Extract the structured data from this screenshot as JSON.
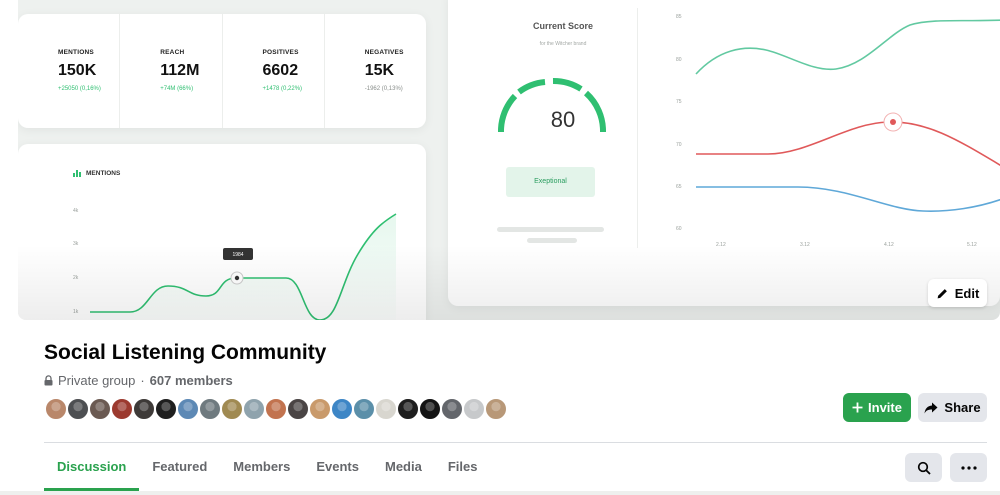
{
  "cover": {
    "stats": [
      {
        "label": "MENTIONS",
        "value": "150K",
        "delta": "+25050 (0,16%)",
        "trend": "positive"
      },
      {
        "label": "REACH",
        "value": "112M",
        "delta": "+74M (66%)",
        "trend": "positive"
      },
      {
        "label": "POSITIVES",
        "value": "6602",
        "delta": "+1478 (0,22%)",
        "trend": "positive"
      },
      {
        "label": "NEGATIVES",
        "value": "15K",
        "delta": "-1962 (0,13%)",
        "trend": "negative"
      }
    ],
    "mentions_chart": {
      "title": "MENTIONS",
      "yticks": [
        "4k",
        "3k",
        "2k",
        "1k"
      ],
      "tooltip": "1984",
      "line_color": "#2fbf71"
    },
    "score": {
      "title": "Current Score",
      "subtitle": "for the Witcher brand",
      "value": "80",
      "badge": "Exeptional",
      "gauge_color": "#2fbf71"
    },
    "trend_chart": {
      "yticks": [
        "85",
        "80",
        "75",
        "70",
        "65",
        "60"
      ],
      "xticks": [
        "2.12",
        "3.12",
        "4.12",
        "5.12"
      ],
      "series_colors": [
        "#62c9a1",
        "#e0595a",
        "#5fa8d8"
      ]
    },
    "edit_label": "Edit"
  },
  "group": {
    "name": "Social Listening Community",
    "privacy": "Private group",
    "separator": "·",
    "members": "607 members",
    "avatar_colors": [
      "#b9876a",
      "#4d4f52",
      "#6b5a52",
      "#9c3a2f",
      "#3e3a38",
      "#1f1f1f",
      "#5d89b5",
      "#6f7a7f",
      "#a08a52",
      "#8fa3ad",
      "#c2734f",
      "#4a4545",
      "#c99a6b",
      "#3d86c6",
      "#5b8fa9",
      "#d8d6cf",
      "#1e1e1e",
      "#141414",
      "#63666b",
      "#c7c9cb",
      "#b89878"
    ]
  },
  "actions": {
    "invite_label": "Invite",
    "share_label": "Share"
  },
  "tabs": [
    {
      "label": "Discussion",
      "active": true
    },
    {
      "label": "Featured",
      "active": false
    },
    {
      "label": "Members",
      "active": false
    },
    {
      "label": "Events",
      "active": false
    },
    {
      "label": "Media",
      "active": false
    },
    {
      "label": "Files",
      "active": false
    }
  ],
  "colors": {
    "accent": "#2aa24e",
    "secondary_button": "#e4e6eb",
    "muted_text": "#65676b"
  },
  "icons": {
    "privacy": "lock-icon",
    "invite": "plus-icon",
    "share": "share-arrow-icon",
    "edit": "pencil-icon",
    "search": "search-icon",
    "more": "more-dots-icon"
  }
}
